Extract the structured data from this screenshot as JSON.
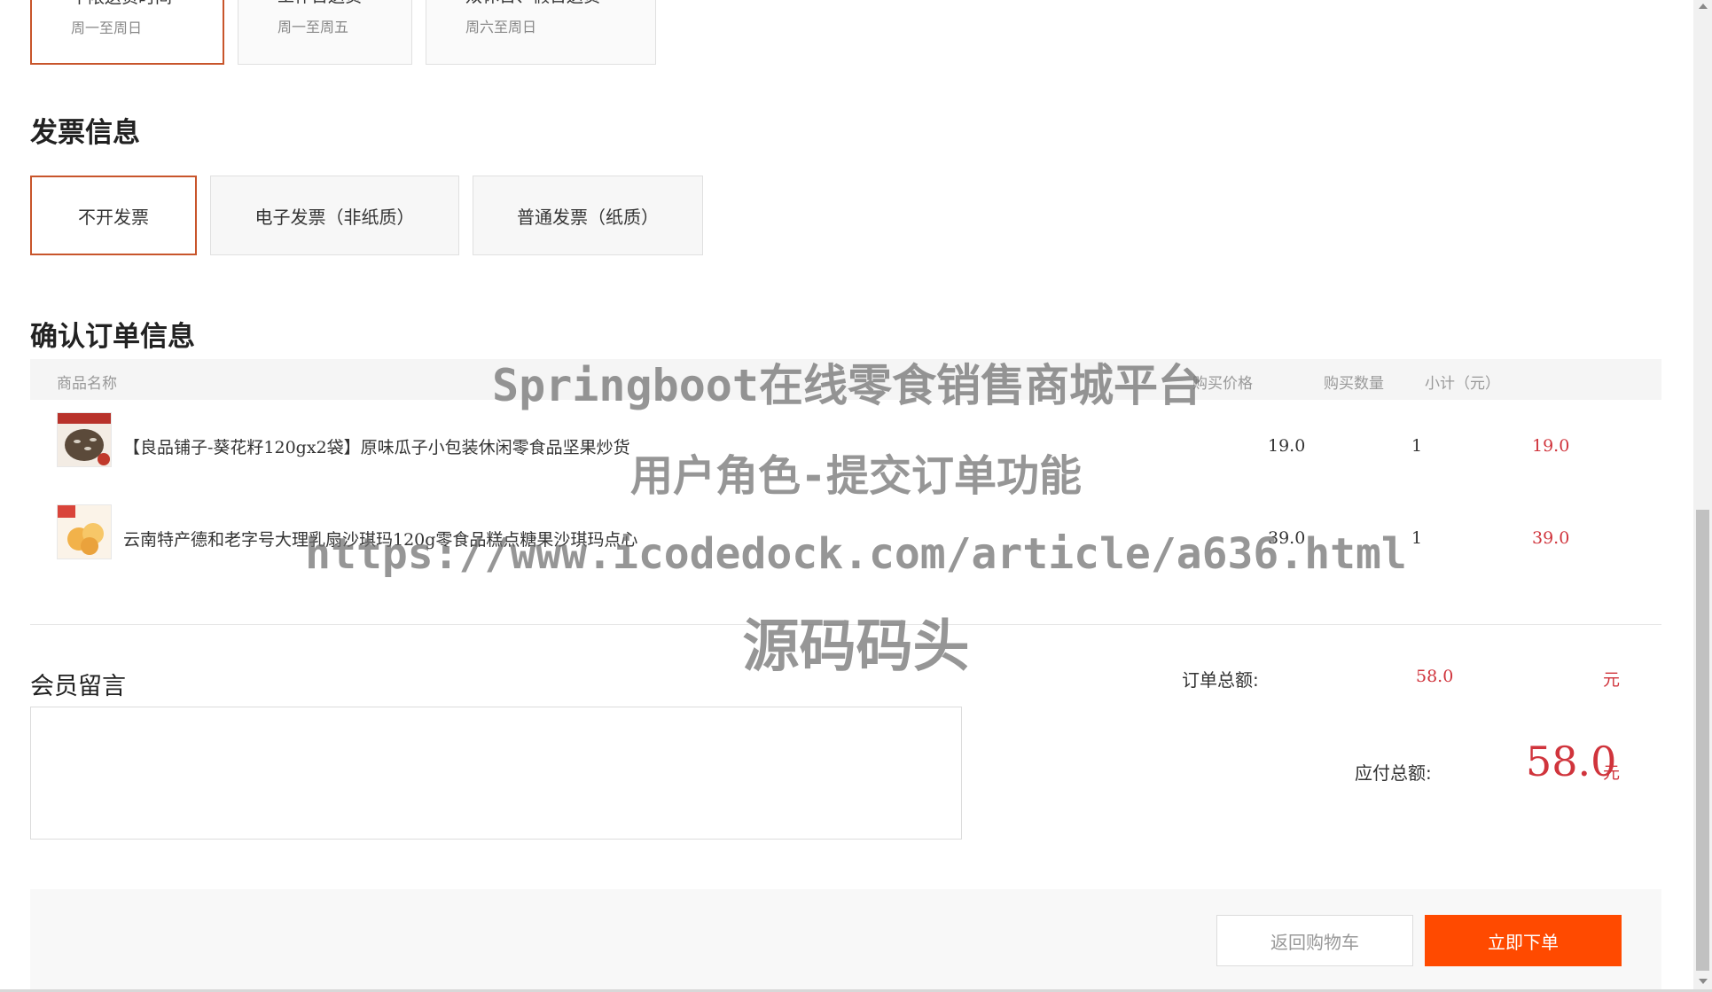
{
  "delivery": {
    "options": [
      {
        "title": "不限送货时间",
        "subtitle": "周一至周日",
        "selected": true
      },
      {
        "title": "工作日送货",
        "subtitle": "周一至周五",
        "selected": false
      },
      {
        "title": "双休日、假日送货",
        "subtitle": "周六至周日",
        "selected": false
      }
    ]
  },
  "invoice": {
    "title": "发票信息",
    "options": [
      {
        "label": "不开发票",
        "selected": true
      },
      {
        "label": "电子发票（非纸质）",
        "selected": false
      },
      {
        "label": "普通发票（纸质）",
        "selected": false
      }
    ]
  },
  "order": {
    "title": "确认订单信息",
    "columns": {
      "name": "商品名称",
      "price": "购买价格",
      "qty": "购买数量",
      "subtotal": "小计（元）"
    },
    "items": [
      {
        "name": "【良品铺子-葵花籽120gx2袋】原味瓜子小包装休闲零食品坚果炒货",
        "price": "19.0",
        "qty": "1",
        "subtotal": "19.0",
        "thumb_icon": "sunflower-seeds-thumbnail"
      },
      {
        "name": "云南特产德和老字号大理乳扇沙琪玛120g零食品糕点糖果沙琪玛点心",
        "price": "39.0",
        "qty": "1",
        "subtotal": "39.0",
        "thumb_icon": "sachima-thumbnail"
      }
    ]
  },
  "memo": {
    "label": "会员留言",
    "value": ""
  },
  "summary": {
    "order_total_label": "订单总额:",
    "order_total_value": "58.0",
    "order_total_unit": "元",
    "payable_label": "应付总额:",
    "payable_value": "58.0",
    "payable_unit": "元"
  },
  "actions": {
    "back_label": "返回购物车",
    "submit_label": "立即下单"
  },
  "watermark": {
    "line1": "Springboot在线零食销售商城平台",
    "line2": "用户角色-提交订单功能",
    "line3": "https://www.icodedock.com/article/a636.html",
    "line4": "源码码头"
  },
  "colors": {
    "accent": "#ff4a00",
    "price_red": "#d0343c",
    "selected_border": "#c8552b"
  }
}
